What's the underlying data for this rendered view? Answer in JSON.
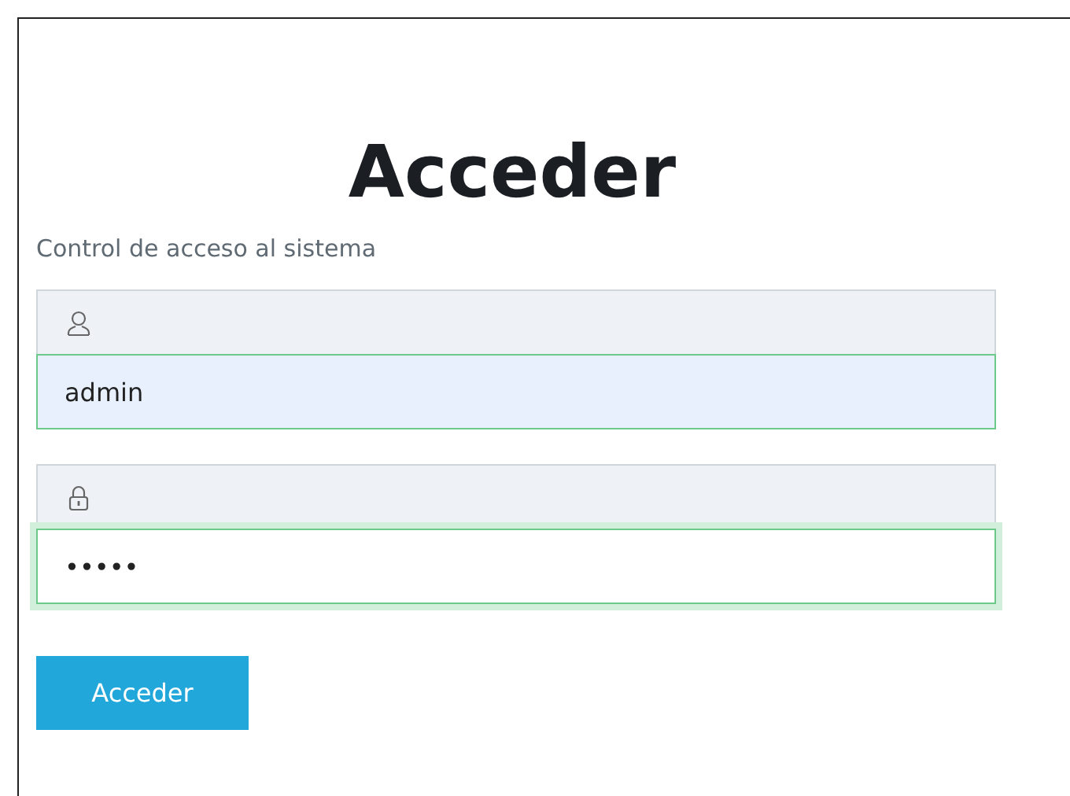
{
  "title": "Acceder",
  "subtitle": "Control de acceso al sistema",
  "fields": [
    {
      "kind": "user",
      "value": "admin",
      "autofilled": true,
      "focused": false
    },
    {
      "kind": "password",
      "value": "•••••",
      "autofilled": false,
      "focused": true
    }
  ],
  "submit_button": "Acceder"
}
